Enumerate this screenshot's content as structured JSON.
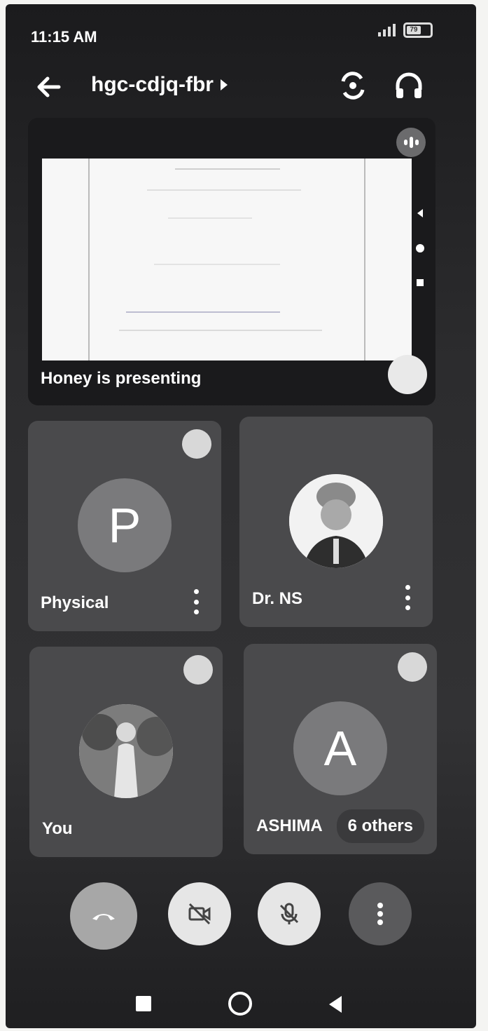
{
  "status_bar": {
    "time": "11:15 AM",
    "battery_label": "79"
  },
  "header": {
    "meeting_code": "hgc-cdjq-fbr"
  },
  "presentation": {
    "label": "Honey is presenting"
  },
  "participants": [
    {
      "name": "Physical",
      "initial": "P",
      "avatar_type": "initial",
      "badge_icon": "mic-off-icon"
    },
    {
      "name": "Dr. NS",
      "initial": "",
      "avatar_type": "photo",
      "badge_icon": ""
    },
    {
      "name": "You",
      "initial": "",
      "avatar_type": "photo",
      "badge_icon": "mic-off-icon"
    },
    {
      "name": "ASHIMA",
      "initial": "A",
      "avatar_type": "initial",
      "badge_icon": "mic-off-icon",
      "others_label": "6 others"
    }
  ],
  "controls": {
    "end_call_icon": "end-call-icon",
    "camera_icon": "camera-off-icon",
    "mic_icon": "mic-off-icon",
    "more_icon": "more-vertical-icon"
  },
  "colors": {
    "accent_dark": "#2c2c2e",
    "tile": "#4a4a4c",
    "avatar": "#7a7a7c",
    "button_light": "#e6e6e6"
  }
}
